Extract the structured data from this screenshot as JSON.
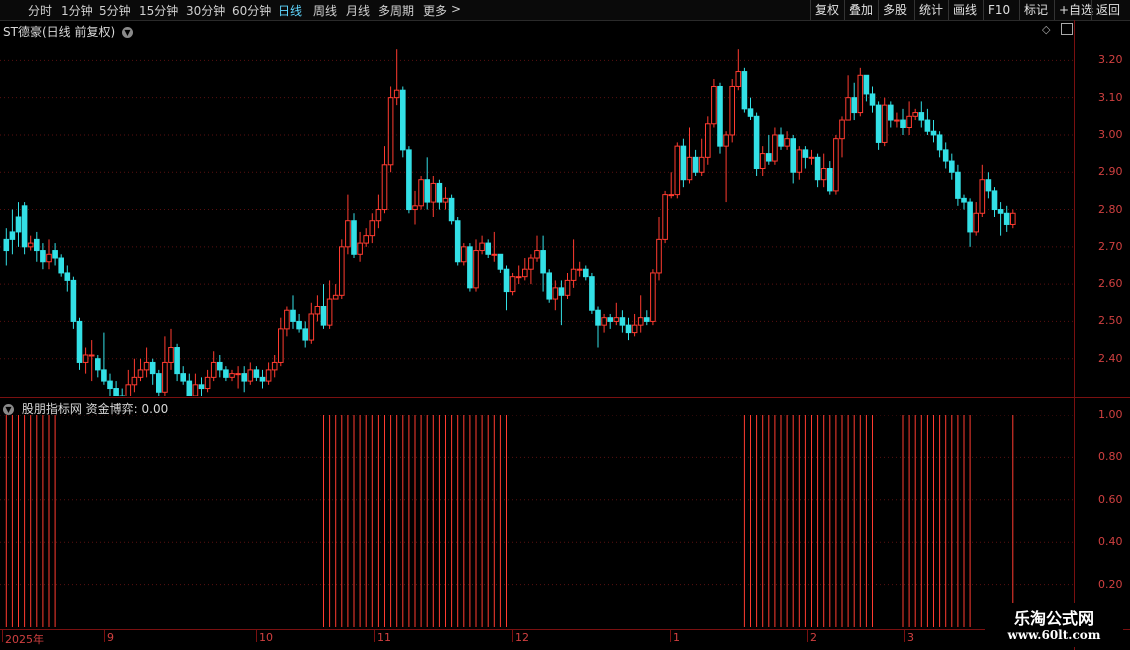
{
  "toolbar": {
    "periods": [
      "分时",
      "1分钟",
      "5分钟",
      "15分钟",
      "30分钟",
      "60分钟",
      "日线",
      "周线",
      "月线",
      "多周期",
      "更多"
    ],
    "active_period": "日线",
    "right_buttons": [
      "复权",
      "叠加",
      "多股",
      "统计",
      "画线",
      "F10",
      "标记",
      "+自选",
      "返回"
    ]
  },
  "main_panel": {
    "title": "ST德豪(日线 前复权)",
    "collapse_icon": "chevron-down-icon"
  },
  "indicator_panel": {
    "title": "股朋指标网  资金博弈: 0.00",
    "collapse_icon": "chevron-down-icon"
  },
  "watermark": {
    "line1": "乐淘公式网",
    "line2": "www.60lt.com"
  },
  "colors": {
    "up": "#ff3b30",
    "down": "#33e0e6",
    "axis": "#7a1010",
    "grid": "#5a1010",
    "active": "#5fd7ff"
  },
  "chart_data": [
    {
      "type": "candlestick",
      "title": "",
      "y_ticks": [
        "3.20",
        "3.10",
        "3.00",
        "2.90",
        "2.80",
        "2.70",
        "2.60",
        "2.50",
        "2.40"
      ],
      "ylim": [
        2.3,
        3.26
      ],
      "x_labels": [
        "2025年",
        "9",
        "10",
        "11",
        "12",
        "1",
        "2",
        "3"
      ],
      "candles": [
        [
          2.72,
          2.69,
          2.65,
          2.75
        ],
        [
          2.74,
          2.72,
          2.68,
          2.8
        ],
        [
          2.78,
          2.74,
          2.7,
          2.82
        ],
        [
          2.81,
          2.7,
          2.68,
          2.82
        ],
        [
          2.7,
          2.71,
          2.69,
          2.73
        ],
        [
          2.72,
          2.69,
          2.66,
          2.74
        ],
        [
          2.69,
          2.66,
          2.64,
          2.71
        ],
        [
          2.66,
          2.68,
          2.64,
          2.72
        ],
        [
          2.69,
          2.67,
          2.65,
          2.71
        ],
        [
          2.67,
          2.63,
          2.62,
          2.68
        ],
        [
          2.63,
          2.61,
          2.58,
          2.65
        ],
        [
          2.61,
          2.5,
          2.48,
          2.62
        ],
        [
          2.5,
          2.39,
          2.37,
          2.51
        ],
        [
          2.39,
          2.41,
          2.36,
          2.43
        ],
        [
          2.41,
          2.41,
          2.34,
          2.45
        ],
        [
          2.4,
          2.37,
          2.35,
          2.41
        ],
        [
          2.37,
          2.34,
          2.33,
          2.47
        ],
        [
          2.34,
          2.32,
          2.29,
          2.36
        ],
        [
          2.32,
          2.3,
          2.29,
          2.34
        ],
        [
          2.3,
          2.29,
          2.26,
          2.32
        ],
        [
          2.29,
          2.33,
          2.28,
          2.37
        ],
        [
          2.33,
          2.35,
          2.31,
          2.4
        ],
        [
          2.35,
          2.37,
          2.34,
          2.4
        ],
        [
          2.37,
          2.39,
          2.35,
          2.43
        ],
        [
          2.39,
          2.36,
          2.33,
          2.4
        ],
        [
          2.36,
          2.31,
          2.27,
          2.37
        ],
        [
          2.31,
          2.39,
          2.3,
          2.46
        ],
        [
          2.39,
          2.43,
          2.37,
          2.48
        ],
        [
          2.43,
          2.36,
          2.34,
          2.44
        ],
        [
          2.36,
          2.34,
          2.33,
          2.38
        ],
        [
          2.34,
          2.3,
          2.29,
          2.36
        ],
        [
          2.3,
          2.33,
          2.3,
          2.36
        ],
        [
          2.33,
          2.32,
          2.3,
          2.35
        ],
        [
          2.32,
          2.35,
          2.31,
          2.37
        ],
        [
          2.35,
          2.39,
          2.34,
          2.42
        ],
        [
          2.39,
          2.37,
          2.35,
          2.41
        ],
        [
          2.37,
          2.35,
          2.34,
          2.38
        ],
        [
          2.35,
          2.36,
          2.34,
          2.37
        ],
        [
          2.36,
          2.36,
          2.32,
          2.38
        ],
        [
          2.36,
          2.34,
          2.31,
          2.38
        ],
        [
          2.34,
          2.37,
          2.33,
          2.39
        ],
        [
          2.37,
          2.35,
          2.34,
          2.38
        ],
        [
          2.35,
          2.34,
          2.32,
          2.37
        ],
        [
          2.34,
          2.37,
          2.33,
          2.39
        ],
        [
          2.37,
          2.39,
          2.35,
          2.41
        ],
        [
          2.39,
          2.48,
          2.38,
          2.51
        ],
        [
          2.48,
          2.53,
          2.46,
          2.54
        ],
        [
          2.53,
          2.5,
          2.48,
          2.57
        ],
        [
          2.5,
          2.48,
          2.47,
          2.52
        ],
        [
          2.48,
          2.45,
          2.43,
          2.5
        ],
        [
          2.45,
          2.52,
          2.44,
          2.55
        ],
        [
          2.52,
          2.54,
          2.5,
          2.57
        ],
        [
          2.54,
          2.49,
          2.48,
          2.6
        ],
        [
          2.49,
          2.56,
          2.48,
          2.61
        ],
        [
          2.56,
          2.57,
          2.56,
          2.6
        ],
        [
          2.57,
          2.7,
          2.56,
          2.72
        ],
        [
          2.7,
          2.77,
          2.68,
          2.84
        ],
        [
          2.77,
          2.68,
          2.67,
          2.79
        ],
        [
          2.68,
          2.71,
          2.66,
          2.74
        ],
        [
          2.71,
          2.73,
          2.7,
          2.75
        ],
        [
          2.73,
          2.77,
          2.71,
          2.79
        ],
        [
          2.77,
          2.8,
          2.75,
          2.84
        ],
        [
          2.8,
          2.92,
          2.79,
          2.97
        ],
        [
          2.92,
          3.1,
          2.9,
          3.13
        ],
        [
          3.1,
          3.12,
          3.08,
          3.23
        ],
        [
          3.12,
          2.96,
          2.94,
          3.13
        ],
        [
          2.96,
          2.8,
          2.79,
          2.97
        ],
        [
          2.8,
          2.81,
          2.76,
          2.85
        ],
        [
          2.81,
          2.88,
          2.8,
          2.89
        ],
        [
          2.88,
          2.82,
          2.8,
          2.94
        ],
        [
          2.82,
          2.87,
          2.78,
          2.89
        ],
        [
          2.87,
          2.82,
          2.8,
          2.88
        ],
        [
          2.82,
          2.83,
          2.8,
          2.86
        ],
        [
          2.83,
          2.77,
          2.76,
          2.84
        ],
        [
          2.77,
          2.66,
          2.65,
          2.78
        ],
        [
          2.66,
          2.7,
          2.65,
          2.71
        ],
        [
          2.7,
          2.59,
          2.58,
          2.71
        ],
        [
          2.59,
          2.69,
          2.58,
          2.72
        ],
        [
          2.69,
          2.71,
          2.68,
          2.73
        ],
        [
          2.71,
          2.68,
          2.67,
          2.72
        ],
        [
          2.68,
          2.68,
          2.66,
          2.74
        ],
        [
          2.68,
          2.64,
          2.63,
          2.68
        ],
        [
          2.64,
          2.58,
          2.53,
          2.65
        ],
        [
          2.58,
          2.62,
          2.57,
          2.63
        ],
        [
          2.62,
          2.62,
          2.6,
          2.65
        ],
        [
          2.62,
          2.64,
          2.61,
          2.67
        ],
        [
          2.64,
          2.67,
          2.6,
          2.68
        ],
        [
          2.67,
          2.69,
          2.66,
          2.73
        ],
        [
          2.69,
          2.63,
          2.58,
          2.73
        ],
        [
          2.63,
          2.56,
          2.55,
          2.64
        ],
        [
          2.56,
          2.59,
          2.53,
          2.61
        ],
        [
          2.59,
          2.57,
          2.49,
          2.61
        ],
        [
          2.57,
          2.61,
          2.56,
          2.63
        ],
        [
          2.61,
          2.64,
          2.59,
          2.72
        ],
        [
          2.64,
          2.64,
          2.62,
          2.66
        ],
        [
          2.64,
          2.62,
          2.61,
          2.65
        ],
        [
          2.62,
          2.53,
          2.52,
          2.63
        ],
        [
          2.53,
          2.49,
          2.43,
          2.54
        ],
        [
          2.49,
          2.51,
          2.47,
          2.52
        ],
        [
          2.51,
          2.5,
          2.48,
          2.52
        ],
        [
          2.5,
          2.51,
          2.49,
          2.55
        ],
        [
          2.51,
          2.49,
          2.47,
          2.53
        ],
        [
          2.49,
          2.47,
          2.45,
          2.51
        ],
        [
          2.47,
          2.49,
          2.46,
          2.52
        ],
        [
          2.49,
          2.51,
          2.47,
          2.57
        ],
        [
          2.51,
          2.5,
          2.49,
          2.53
        ],
        [
          2.5,
          2.63,
          2.49,
          2.64
        ],
        [
          2.63,
          2.72,
          2.61,
          2.78
        ],
        [
          2.72,
          2.84,
          2.71,
          2.85
        ],
        [
          2.84,
          2.84,
          2.83,
          2.9
        ],
        [
          2.84,
          2.97,
          2.83,
          2.98
        ],
        [
          2.97,
          2.88,
          2.86,
          2.99
        ],
        [
          2.88,
          2.94,
          2.87,
          3.02
        ],
        [
          2.94,
          2.9,
          2.89,
          2.96
        ],
        [
          2.9,
          2.94,
          2.89,
          2.99
        ],
        [
          2.94,
          3.03,
          2.92,
          3.05
        ],
        [
          3.03,
          3.13,
          3.02,
          3.15
        ],
        [
          3.13,
          2.97,
          2.95,
          3.14
        ],
        [
          2.97,
          3.0,
          2.82,
          3.01
        ],
        [
          3.0,
          3.13,
          2.98,
          3.15
        ],
        [
          3.13,
          3.17,
          3.12,
          3.23
        ],
        [
          3.17,
          3.07,
          3.06,
          3.18
        ],
        [
          3.07,
          3.05,
          3.04,
          3.1
        ],
        [
          3.05,
          2.91,
          2.89,
          3.06
        ],
        [
          2.91,
          2.95,
          2.89,
          2.97
        ],
        [
          2.95,
          2.93,
          2.92,
          3.0
        ],
        [
          2.93,
          3.0,
          2.92,
          3.02
        ],
        [
          3.0,
          2.97,
          2.96,
          3.02
        ],
        [
          2.97,
          2.99,
          2.96,
          3.01
        ],
        [
          2.99,
          2.9,
          2.87,
          3.0
        ],
        [
          2.9,
          2.96,
          2.88,
          2.97
        ],
        [
          2.96,
          2.94,
          2.91,
          2.97
        ],
        [
          2.94,
          2.94,
          2.92,
          2.96
        ],
        [
          2.94,
          2.88,
          2.86,
          2.95
        ],
        [
          2.88,
          2.91,
          2.86,
          2.95
        ],
        [
          2.91,
          2.85,
          2.84,
          2.93
        ],
        [
          2.85,
          2.99,
          2.84,
          3.0
        ],
        [
          2.99,
          3.04,
          2.94,
          3.05
        ],
        [
          3.04,
          3.1,
          3.04,
          3.16
        ],
        [
          3.1,
          3.06,
          3.04,
          3.14
        ],
        [
          3.06,
          3.16,
          3.05,
          3.18
        ],
        [
          3.16,
          3.11,
          3.09,
          3.16
        ],
        [
          3.11,
          3.08,
          3.06,
          3.13
        ],
        [
          3.08,
          2.98,
          2.96,
          3.09
        ],
        [
          2.98,
          3.08,
          2.97,
          3.1
        ],
        [
          3.08,
          3.04,
          3.02,
          3.09
        ],
        [
          3.04,
          3.04,
          3.02,
          3.06
        ],
        [
          3.04,
          3.02,
          3.0,
          3.07
        ],
        [
          3.02,
          3.05,
          3.0,
          3.09
        ],
        [
          3.05,
          3.06,
          3.04,
          3.07
        ],
        [
          3.06,
          3.04,
          3.02,
          3.09
        ],
        [
          3.04,
          3.01,
          3.0,
          3.07
        ],
        [
          3.01,
          3.0,
          2.98,
          3.04
        ],
        [
          3.0,
          2.96,
          2.94,
          3.01
        ],
        [
          2.96,
          2.93,
          2.91,
          2.98
        ],
        [
          2.93,
          2.9,
          2.88,
          2.95
        ],
        [
          2.9,
          2.83,
          2.81,
          2.92
        ],
        [
          2.83,
          2.82,
          2.8,
          2.84
        ],
        [
          2.82,
          2.74,
          2.7,
          2.83
        ],
        [
          2.74,
          2.79,
          2.73,
          2.82
        ],
        [
          2.79,
          2.88,
          2.78,
          2.92
        ],
        [
          2.88,
          2.85,
          2.83,
          2.9
        ],
        [
          2.85,
          2.8,
          2.78,
          2.86
        ],
        [
          2.8,
          2.79,
          2.73,
          2.82
        ],
        [
          2.79,
          2.76,
          2.74,
          2.81
        ],
        [
          2.76,
          2.79,
          2.75,
          2.8
        ]
      ]
    },
    {
      "type": "bar",
      "title": "资金博弈",
      "y_ticks": [
        "1.00",
        "0.80",
        "0.60",
        "0.40",
        "0.20"
      ],
      "ylim": [
        0,
        1.0
      ],
      "signal_ranges": [
        [
          0,
          8
        ],
        [
          52,
          82
        ],
        [
          121,
          142
        ],
        [
          147,
          158
        ],
        [
          165,
          165
        ]
      ]
    }
  ]
}
